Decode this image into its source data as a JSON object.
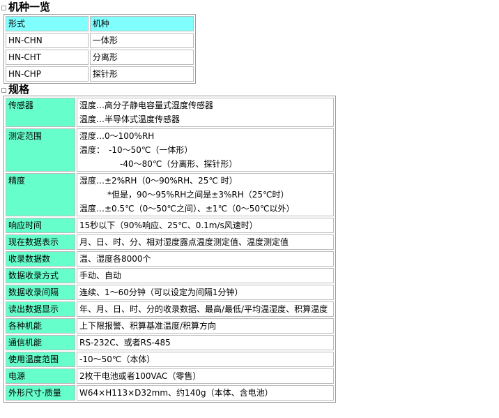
{
  "models_section": {
    "title": "机种一览",
    "headers": [
      "形式",
      "机种"
    ],
    "rows": [
      [
        "HN-CHN",
        "一体形"
      ],
      [
        "HN-CHT",
        "分离形"
      ],
      [
        "HN-CHP",
        "探针形"
      ]
    ]
  },
  "spec_section": {
    "title": "规格",
    "rows": [
      {
        "label": "传感器",
        "lines": [
          "湿度…高分子静电容量式湿度传感器",
          "温度…半导体式温度传感器"
        ]
      },
      {
        "label": "测定范围",
        "lines": [
          "湿度…0～100%RH",
          "温度：　-10～50℃（一体形）",
          "-40～80℃（分离形、探针形）"
        ]
      },
      {
        "label": "精度",
        "lines": [
          "湿度…±2%RH（0～90%RH、25℃ 时）",
          "*但是，90～95%RH之间是±3%RH（25℃时）",
          "温度…±0.5℃（0～50℃之间）、±1℃（0～50℃以外）"
        ]
      },
      {
        "label": "响应时间",
        "value": "15秒以下（90%响应、25℃、0.1m/s风速时）"
      },
      {
        "label": "现在数据表示",
        "value": "月、日、时、分、相对湿度露点温度测定值、温度测定值"
      },
      {
        "label": "收录数据数",
        "value": "温、湿度各8000个"
      },
      {
        "label": "数据收录方式",
        "value": "手动、自动"
      },
      {
        "label": "数据收录间隔",
        "value": "连续、1～60分钟（可以设定为间隔1分钟）"
      },
      {
        "label": "读出数据显示",
        "value": "年、月、日、时、分的收录数据、最高/最低/平均温湿度、积算温度"
      },
      {
        "label": "各种机能",
        "value": "上下限报警、积算基准温度/积算方向"
      },
      {
        "label": "通信机能",
        "value": "RS-232C、或者RS-485"
      },
      {
        "label": "使用温度范围",
        "value": "-10～50℃（本体）"
      },
      {
        "label": "电源",
        "value": "2枚干电池或者100VAC（零售）"
      },
      {
        "label": "外形尺寸·质量",
        "value": "W64×H113×D32mm、约140g（本体、含电池）"
      }
    ]
  }
}
